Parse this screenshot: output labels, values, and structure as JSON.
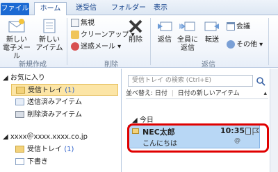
{
  "tabs": [
    "ファイル",
    "ホーム",
    "送受信",
    "フォルダー",
    "表示"
  ],
  "ribbon": {
    "new_email": [
      "新しい",
      "電子メール"
    ],
    "new_items": [
      "新しい",
      "アイテム"
    ],
    "group_new": "新規作成",
    "ignore": "無視",
    "cleanup": "クリーンアップ",
    "junk": "迷惑メール",
    "delete": "削除",
    "group_delete": "削除",
    "reply": "返信",
    "reply_all": [
      "全員に",
      "返信"
    ],
    "forward": "転送",
    "meeting": "会議",
    "more": "その他",
    "group_respond": "返信"
  },
  "nav": {
    "favorites": "お気に入り",
    "inbox": "受信トレイ",
    "inbox_count": "(1)",
    "sent": "送信済みアイテム",
    "deleted": "削除済みアイテム",
    "account": "xxxx＠xxxx.xxxx.co.jp",
    "inbox2": "受信トレイ",
    "inbox2_count": "(1)",
    "drafts": "下書き"
  },
  "list": {
    "search_placeholder": "受信トレイ の検索 (Ctrl+E)",
    "sort_label": "並べ替え: 日付",
    "sort_order": "日付の新しいアイテム",
    "group_today": "今日",
    "mail": {
      "sender": "NEC太郎",
      "time": "10:35",
      "subject": "こんにちは"
    }
  },
  "colors": {
    "accent": "#1c6ad3",
    "highlight": "#e00000",
    "selected": "#fce5a6"
  }
}
